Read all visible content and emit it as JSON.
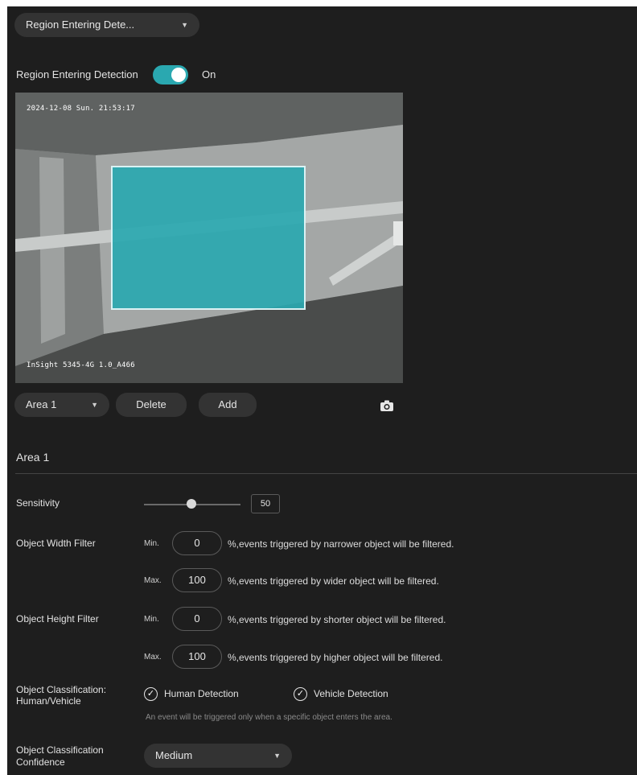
{
  "detection_type_select": {
    "value": "Region Entering Dete..."
  },
  "toggle_row": {
    "label": "Region Entering Detection",
    "state": "On"
  },
  "video": {
    "timestamp": "2024-12-08 Sun. 21:53:17",
    "camera_name": "InSight 5345-4G 1.0_A466"
  },
  "area_controls": {
    "area_select": "Area 1",
    "delete_label": "Delete",
    "add_label": "Add",
    "snapshot_icon": "camera-icon"
  },
  "section_title": "Area 1",
  "sensitivity": {
    "label": "Sensitivity",
    "value": "50",
    "level": 0.5
  },
  "width_filter": {
    "label": "Object Width Filter",
    "min_label": "Min.",
    "min_value": "0",
    "min_hint": "%,events triggered by narrower object will be filtered.",
    "max_label": "Max.",
    "max_value": "100",
    "max_hint": "%,events triggered by wider object will be filtered."
  },
  "height_filter": {
    "label": "Object Height Filter",
    "min_label": "Min.",
    "min_value": "0",
    "min_hint": "%,events triggered by shorter object will be filtered.",
    "max_label": "Max.",
    "max_value": "100",
    "max_hint": "%,events triggered by higher object will be filtered."
  },
  "classification": {
    "label_line1": "Object Classification:",
    "label_line2": "Human/Vehicle",
    "human_label": "Human Detection",
    "vehicle_label": "Vehicle Detection",
    "note": "An event will be triggered only when a specific object enters the area."
  },
  "confidence": {
    "label_line1": "Object Classification",
    "label_line2": "Confidence",
    "value": "Medium"
  },
  "colors": {
    "accent": "#2aa8b0",
    "panel": "#1e1e1e",
    "control": "#333333"
  }
}
